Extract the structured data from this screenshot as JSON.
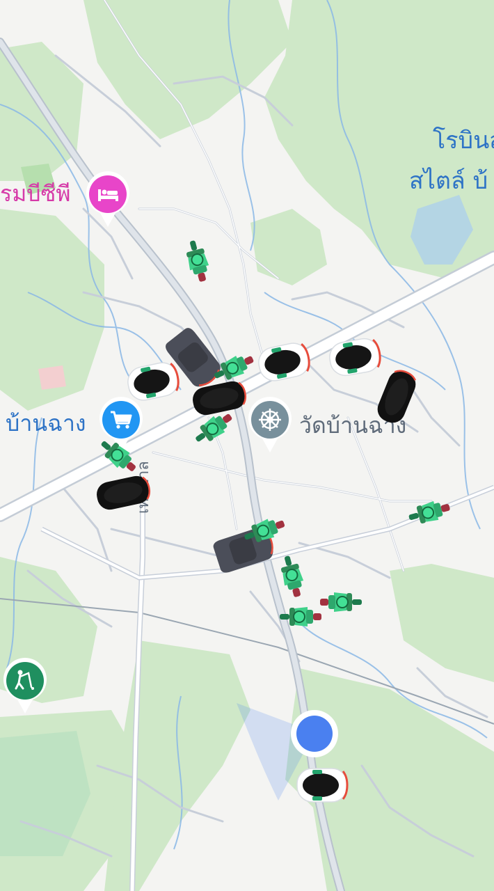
{
  "map": {
    "labels": {
      "hotel": "รมบีซีพี",
      "market": "บ้านฉาง",
      "temple": "วัดบ้านฉาง",
      "robinson_line1": "โรบินส",
      "robinson_line2": "สไตล์ บ้",
      "road_name": "เทศบาล"
    },
    "pins": {
      "hotel": {
        "icon": "bed-icon",
        "color": "#e845c9"
      },
      "market": {
        "icon": "shopping-cart-icon",
        "color": "#2196f3"
      },
      "temple": {
        "icon": "dharma-wheel-icon",
        "color": "#78909c"
      },
      "golf": {
        "icon": "golf-icon",
        "color": "#1f8f5f"
      }
    },
    "colors": {
      "background": "#f4f4f2",
      "green_area": "#cfe8c8",
      "road": "#ffffff",
      "road_edge": "#c7ced9",
      "waterway": "#8ab7e6",
      "user_location": "#4a80f0",
      "motorbike": "#3fd18a",
      "label_blue": "#2e73c6",
      "label_pink": "#d63aa8",
      "label_gray": "#5f6b7a"
    }
  }
}
